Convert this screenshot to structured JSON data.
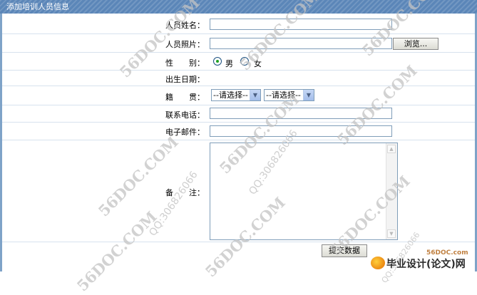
{
  "title": "添加培训人员信息",
  "fields": {
    "name_label": "人员姓名：",
    "photo_label": "人员照片：",
    "browse_label": "浏览...",
    "gender_label": "性　　别：",
    "gender_male": "男",
    "gender_female": "女",
    "gender_selected": "男",
    "birth_label": "出生日期：",
    "origin_label": "籍　　贯：",
    "province_select": "--请选择--",
    "city_select": "--请选择--",
    "phone_label": "联系电话：",
    "email_label": "电子邮件：",
    "remark_label": "备　　注："
  },
  "submit_label": "提交数据",
  "watermark_text": "56DOC.COM",
  "watermark_qq": "QQ:306826066",
  "brand": {
    "site": "56DOC.com",
    "name": "毕业设计(论文)网"
  },
  "colors": {
    "titlebar": "#5b86b8",
    "row_border": "#d7e2ee",
    "frame": "#7fa3c8"
  },
  "icons": [
    "chevron-down-icon",
    "radio-icon",
    "scroll-up-icon",
    "scroll-down-icon",
    "brand-logo-icon"
  ]
}
